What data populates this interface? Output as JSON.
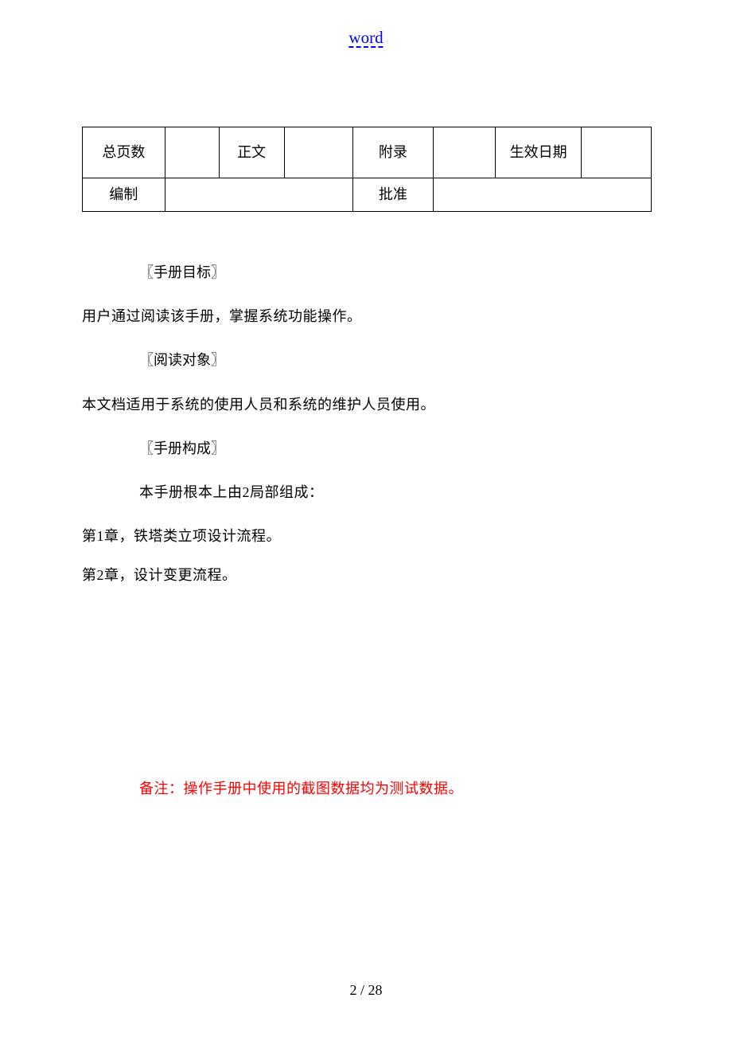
{
  "header": {
    "word_link": "word"
  },
  "table": {
    "row1": {
      "total_pages_label": "总页数",
      "total_pages_value": "",
      "body_label": "正文",
      "body_value": "",
      "appendix_label": "附录",
      "appendix_value": "",
      "effective_date_label": "生效日期",
      "effective_date_value": ""
    },
    "row2": {
      "compiled_label": "编制",
      "compiled_value": "",
      "approved_label": "批准",
      "approved_value": ""
    }
  },
  "body": {
    "section1_title": "〖手册目标〗",
    "section1_text": "用户通过阅读该手册，掌握系统功能操作。",
    "section2_title": "〖阅读对象〗",
    "section2_text": "本文档适用于系统的使用人员和系统的维护人员使用。",
    "section3_title": "〖手册构成〗",
    "section3_intro": "本手册根本上由2局部组成：",
    "chapter1": "第1章，铁塔类立项设计流程。",
    "chapter2": "第2章，设计变更流程。",
    "remark": "备注：操作手册中使用的截图数据均为测试数据。"
  },
  "footer": {
    "page_number": "2 / 28"
  }
}
